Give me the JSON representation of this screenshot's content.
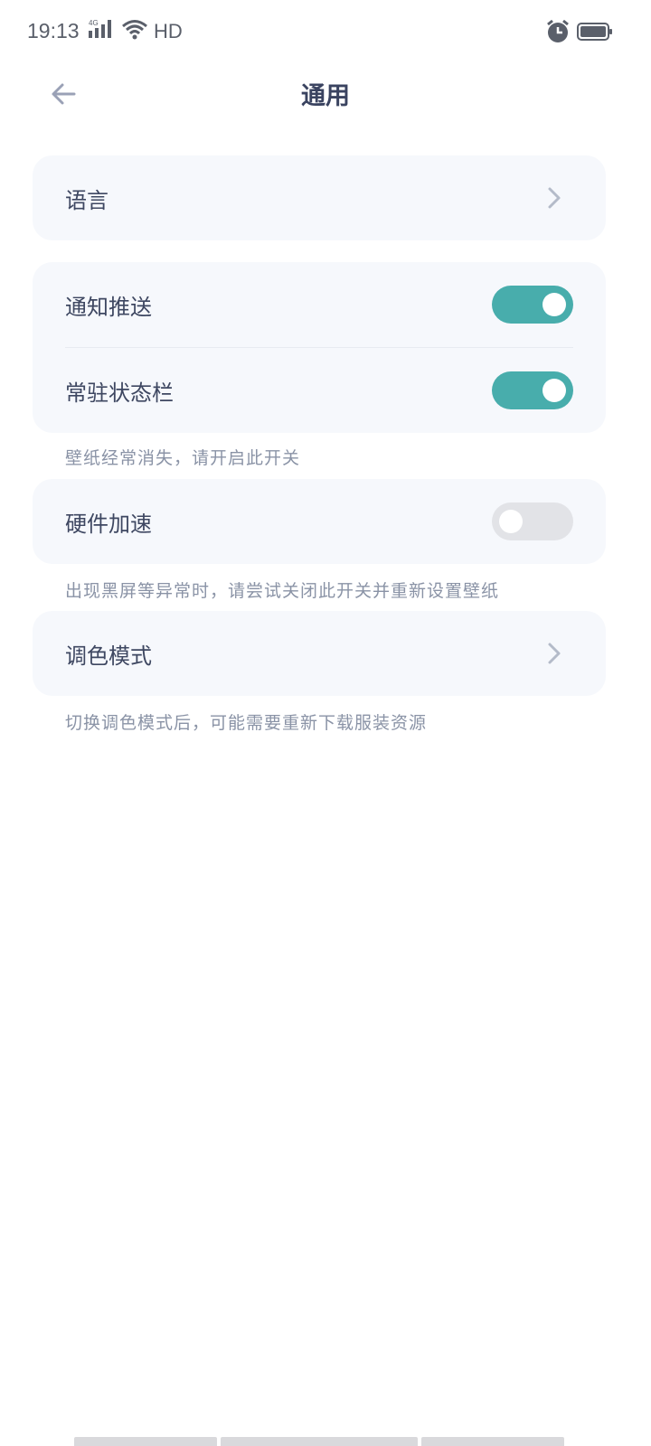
{
  "status_bar": {
    "time": "19:13",
    "network": "4G",
    "hd": "HD"
  },
  "header": {
    "title": "通用",
    "back_icon": "arrow-left-icon"
  },
  "settings": {
    "language": {
      "label": "语言"
    },
    "notification_push": {
      "label": "通知推送",
      "enabled": true
    },
    "resident_statusbar": {
      "label": "常驻状态栏",
      "enabled": true,
      "hint": "壁纸经常消失，请开启此开关"
    },
    "hardware_accel": {
      "label": "硬件加速",
      "enabled": false,
      "hint": "出现黑屏等异常时，请尝试关闭此开关并重新设置壁纸"
    },
    "palette_mode": {
      "label": "调色模式",
      "hint": "切换调色模式后，可能需要重新下载服装资源"
    }
  },
  "colors": {
    "accent": "#48adac",
    "card_bg": "#f6f8fc",
    "toggle_off": "#e2e3e7",
    "text_primary": "#3e4761",
    "text_hint": "#8a93a6"
  }
}
